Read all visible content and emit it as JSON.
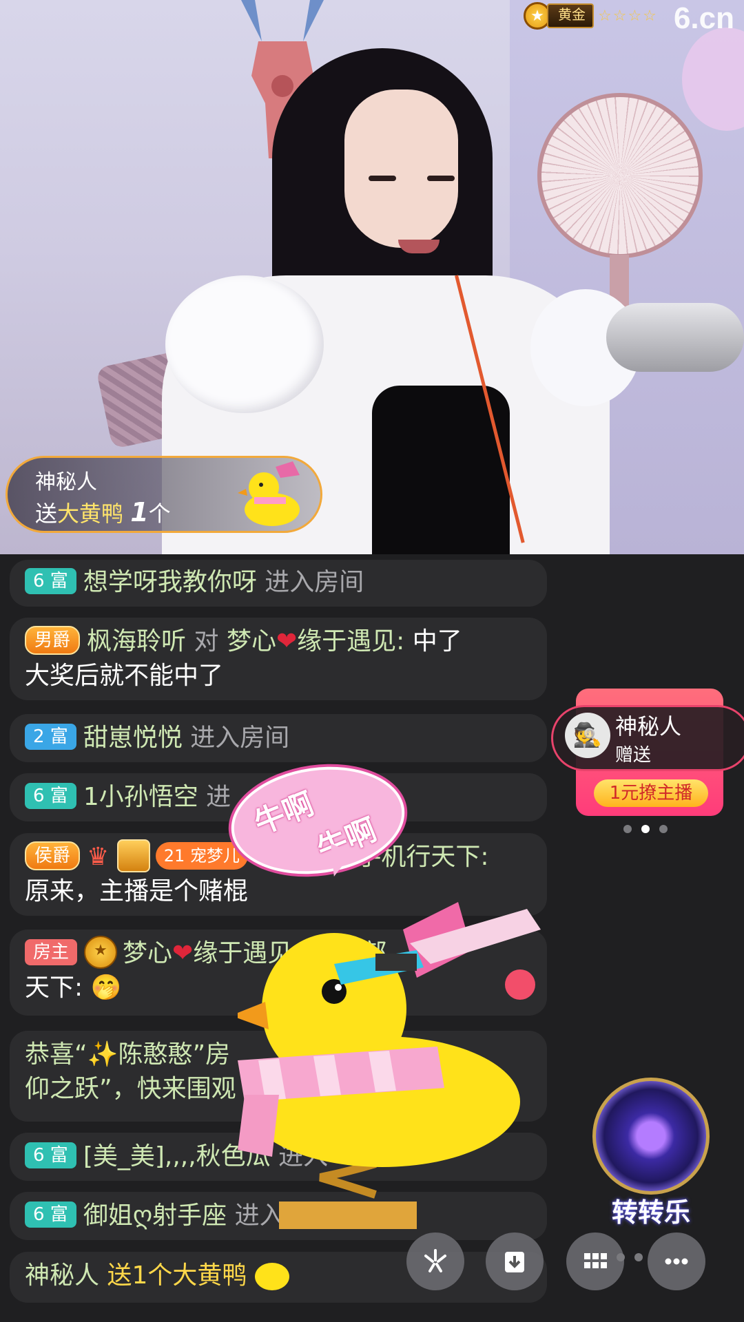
{
  "stream": {
    "rank_label": "黄金",
    "rank_stars": "☆☆☆☆",
    "logo": "6.cn"
  },
  "gift_notice": {
    "sender": "神秘人",
    "verb": "送",
    "gift_name": "大黄鸭",
    "count": "1",
    "unit": "个"
  },
  "chat": {
    "r1": {
      "badge": "6 富",
      "name": "想学呀我教你呀",
      "action": "进入房间"
    },
    "r2": {
      "badge": "男爵",
      "name": "枫海聆听",
      "to": "对",
      "target": "梦心",
      "heart": "❤",
      "target2": "缘于遇见:",
      "msg1": " 中了",
      "msg2": "大奖后就不能中了"
    },
    "r3": {
      "badge": "2 富",
      "name": "甜崽悦悦",
      "action": "进入房间"
    },
    "r4": {
      "badge": "6 富",
      "name": "1小孙悟空",
      "action": "进"
    },
    "r5": {
      "badge": "侯爵",
      "crown": "♛",
      "pill_num": "21",
      "pill_name": "宠梦儿",
      "tail": "部手机行天下:",
      "msg": "原来，主播是个赌棍"
    },
    "r6": {
      "badge": "房主",
      "name": "梦心",
      "heart": "❤",
      "name2": "缘于遇见",
      "tail": "部",
      "msg": "天下:",
      "emoji": "🤭"
    },
    "r7": {
      "line1": "恭喜“✨陈憨憨”房",
      "line2": "仰之跃”，快来围观"
    },
    "r8": {
      "badge": "6 富",
      "name": "[美_美],,,,秋色瓜",
      "action": "进入"
    },
    "r9": {
      "badge": "6 富",
      "name": "御姐ღ射手座",
      "action": "进入房"
    },
    "r10": {
      "name": "神秘人",
      "action": "送1个大黄鸭"
    }
  },
  "promo": {
    "name": "神秘人",
    "sub": "赠送",
    "button": "1元撩主播"
  },
  "wheel": {
    "label": "转转乐"
  },
  "reaction": {
    "t1": "牛啊",
    "t2": "牛啊"
  },
  "toolbar": {
    "b1": "sparkle-icon",
    "b2": "download-icon",
    "b3": "grid-icon",
    "b4": "more-icon"
  }
}
